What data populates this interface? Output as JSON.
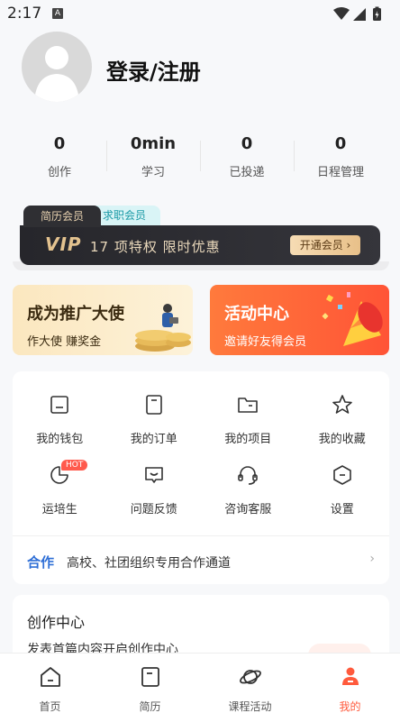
{
  "status_bar": {
    "time": "2:17",
    "notif_badge": "A"
  },
  "profile": {
    "login_label": "登录/注册"
  },
  "stats": [
    {
      "value": "0",
      "label": "创作"
    },
    {
      "value": "0min",
      "label": "学习"
    },
    {
      "value": "0",
      "label": "已投递"
    },
    {
      "value": "0",
      "label": "日程管理"
    }
  ],
  "vip": {
    "tab_resume": "简历会员",
    "tab_job": "求职会员",
    "logo": "VIP",
    "promo_text": "17 项特权  限时优惠",
    "cta": "开通会员 ›"
  },
  "promos": {
    "left": {
      "title": "成为推广大使",
      "subtitle": "作大使 赚奖金"
    },
    "right": {
      "title": "活动中心",
      "subtitle": "邀请好友得会员"
    }
  },
  "grid": {
    "items": [
      {
        "label": "我的钱包",
        "icon": "wallet-icon"
      },
      {
        "label": "我的订单",
        "icon": "order-icon"
      },
      {
        "label": "我的项目",
        "icon": "folder-icon"
      },
      {
        "label": "我的收藏",
        "icon": "star-icon"
      },
      {
        "label": "运培生",
        "icon": "pie-chart-icon",
        "badge": "HOT"
      },
      {
        "label": "问题反馈",
        "icon": "feedback-icon"
      },
      {
        "label": "咨询客服",
        "icon": "headset-icon"
      },
      {
        "label": "设置",
        "icon": "settings-icon"
      }
    ],
    "coop_label": "合作",
    "coop_text": "高校、社团组织专用合作通道",
    "coop_arrow": "›"
  },
  "creation": {
    "title": "创作中心",
    "subtitle": "发表首篇内容开启创作中心"
  },
  "tabbar": {
    "items": [
      {
        "label": "首页",
        "icon": "home-icon"
      },
      {
        "label": "简历",
        "icon": "resume-icon"
      },
      {
        "label": "课程活动",
        "icon": "planet-icon"
      },
      {
        "label": "我的",
        "icon": "profile-icon",
        "active": true
      }
    ]
  },
  "colors": {
    "accent": "#ff5a3c",
    "coop_blue": "#2f6fd6",
    "vip_gold": "#e3c28f"
  }
}
